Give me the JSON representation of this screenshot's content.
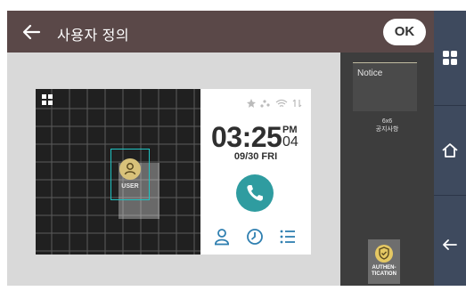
{
  "header": {
    "title": "사용자 정의",
    "ok_label": "OK"
  },
  "preview": {
    "grid": {
      "user_label": "USER"
    },
    "clock": {
      "time": "03:25",
      "ampm": "PM",
      "seconds": "04",
      "date": "09/30 FRI"
    }
  },
  "side_panel": {
    "notice": {
      "title": "Notice",
      "size": "6x6",
      "caption": "공지사항"
    },
    "auth": {
      "label_line1": "AUTHEN-",
      "label_line2": "TICATION"
    }
  },
  "colors": {
    "titlebar": "#5a4848",
    "accent_teal": "#2f9ca0",
    "user_frame": "#1ec3c3",
    "auth_gold": "#e5c863",
    "rail": "#3e4a5e"
  }
}
